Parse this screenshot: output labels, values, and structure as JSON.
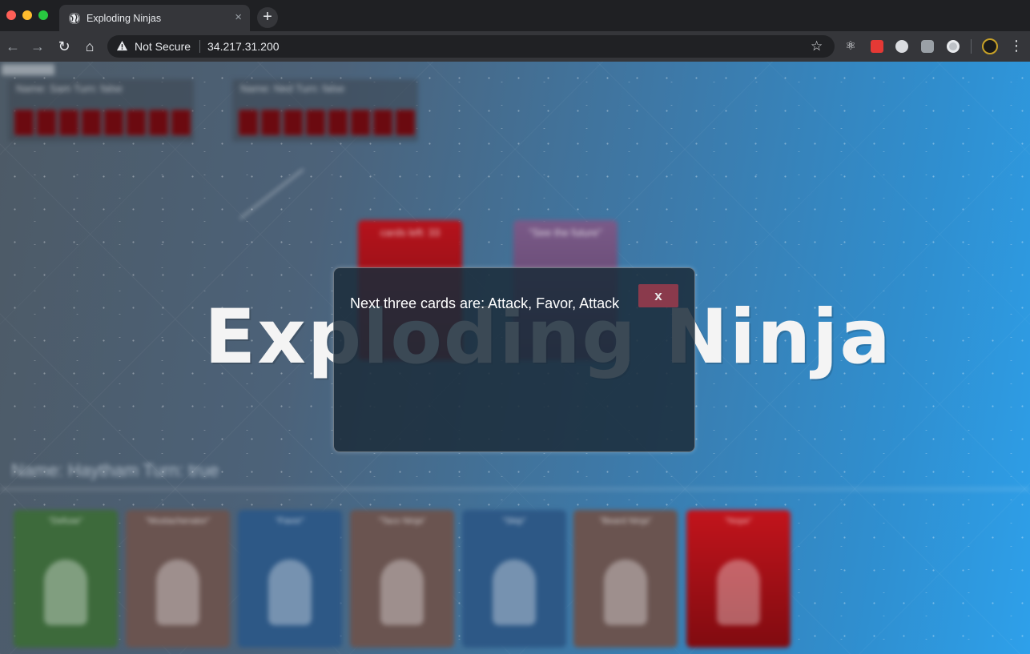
{
  "browser": {
    "tab_title": "Exploding Ninjas",
    "tab_close": "×",
    "new_tab": "+",
    "security_label": "Not Secure",
    "url": "34.217.31.200",
    "star": "☆",
    "menu": "⋮"
  },
  "game": {
    "title": "Exploding Ninja",
    "opponents": [
      {
        "label": "Name: Sam   Turn: false",
        "card_count": 8
      },
      {
        "label": "Name: Ned   Turn: false",
        "card_count": 8
      }
    ],
    "draw_pile_label": "cards left: 33",
    "discard_label": "\"See the future\"",
    "player_line": "Name: Haytham   Turn: true",
    "hand": [
      {
        "label": "\"Defuse\"",
        "color": "#3d6a3b"
      },
      {
        "label": "\"Mustachenator\"",
        "color": "#6a5450"
      },
      {
        "label": "\"Favor\"",
        "color": "#2d5886"
      },
      {
        "label": "\"Taco Ninja\"",
        "color": "#6a5450"
      },
      {
        "label": "\"Skip\"",
        "color": "#2d5886"
      },
      {
        "label": "\"Beard Ninja\"",
        "color": "#6a5450"
      },
      {
        "label": "\"Nope\"",
        "color": "#c2141c"
      }
    ]
  },
  "modal": {
    "message": "Next three cards are: Attack, Favor, Attack",
    "close_label": "x",
    "close_color": "#8a3a4c"
  }
}
